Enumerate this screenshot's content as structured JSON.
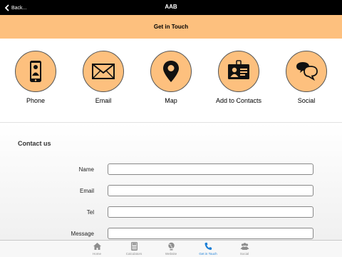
{
  "nav": {
    "back_label": "Back...",
    "title": "AAB"
  },
  "header": {
    "title": "Get in Touch"
  },
  "actions": [
    {
      "label": "Phone",
      "icon": "phone-icon"
    },
    {
      "label": "Email",
      "icon": "envelope-icon"
    },
    {
      "label": "Map",
      "icon": "map-pin-icon"
    },
    {
      "label": "Add to Contacts",
      "icon": "contact-card-icon"
    },
    {
      "label": "Social",
      "icon": "chat-bubbles-icon"
    }
  ],
  "form": {
    "title": "Contact us",
    "fields": [
      {
        "label": "Name",
        "value": ""
      },
      {
        "label": "Email",
        "value": ""
      },
      {
        "label": "Tel",
        "value": ""
      },
      {
        "label": "Message",
        "value": ""
      }
    ]
  },
  "tabs": [
    {
      "label": "Home",
      "icon": "house-icon",
      "active": false
    },
    {
      "label": "Calculators",
      "icon": "calculator-icon",
      "active": false
    },
    {
      "label": "Website",
      "icon": "globe-icon",
      "active": false
    },
    {
      "label": "Get in Touch",
      "icon": "phone-handset-icon",
      "active": true
    },
    {
      "label": "Social",
      "icon": "people-icon",
      "active": false
    }
  ],
  "colors": {
    "accent": "#fdc07e",
    "nav_background": "#000000",
    "active_tab": "#1a7ed6"
  }
}
